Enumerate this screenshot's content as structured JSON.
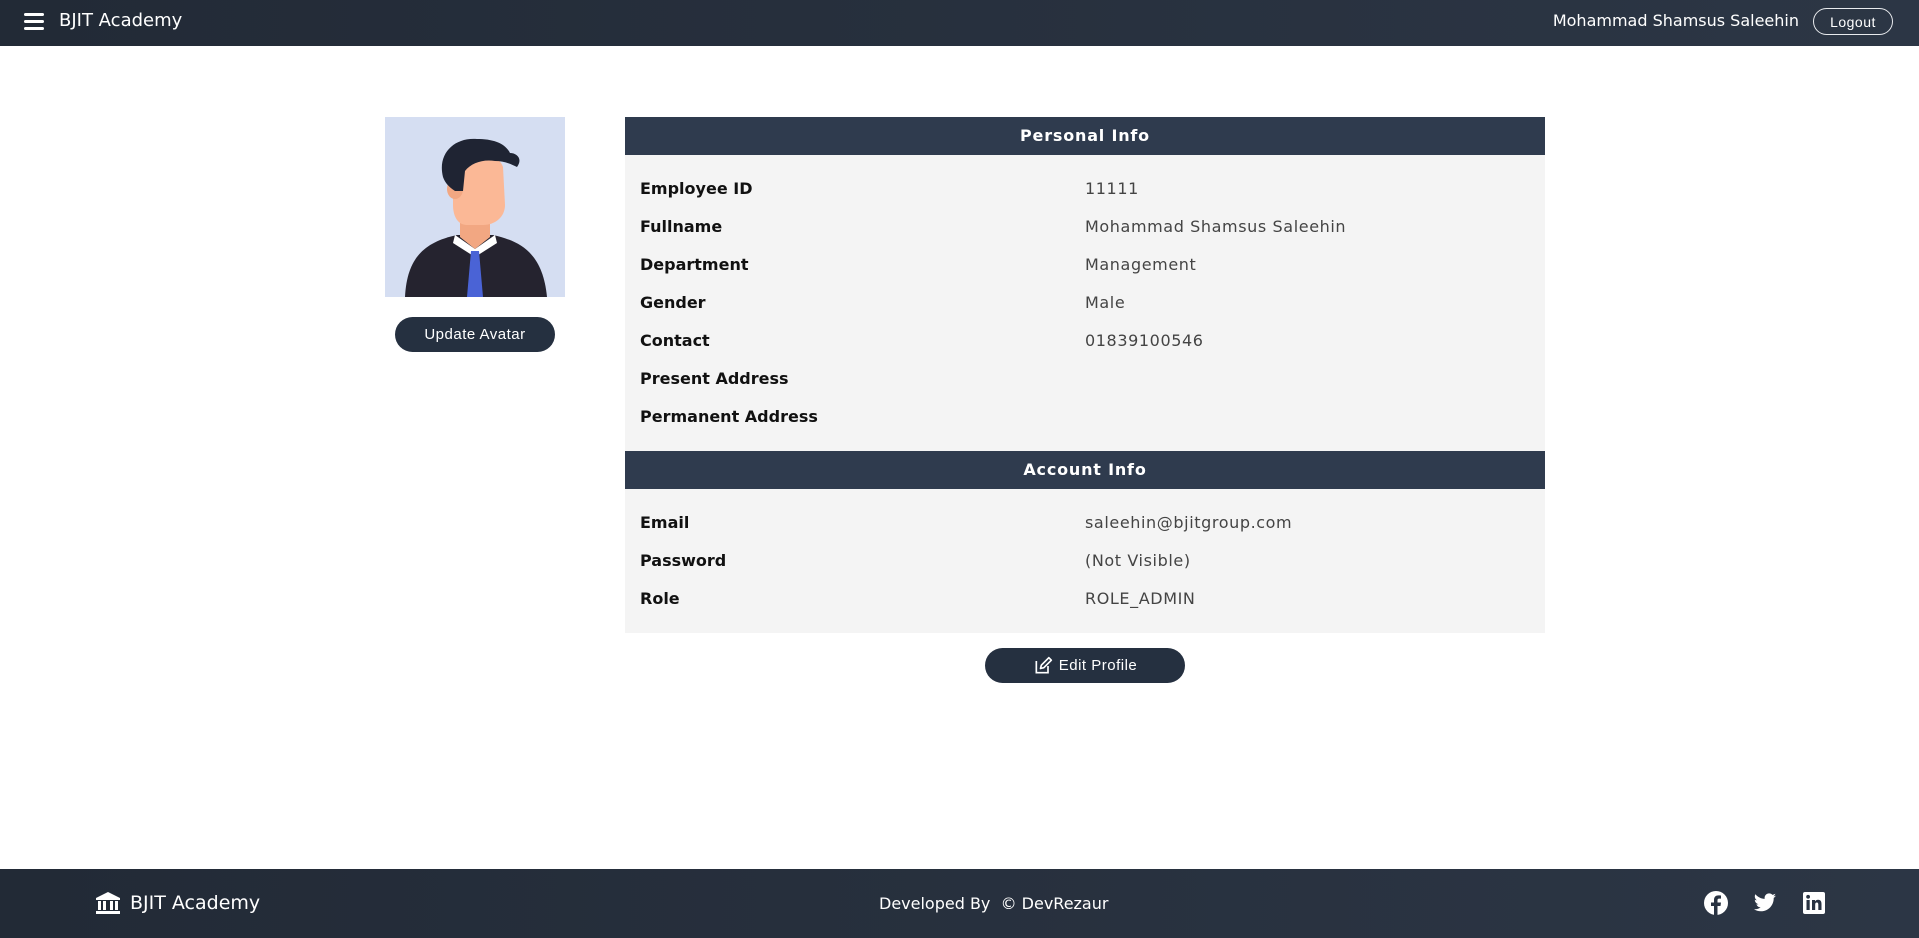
{
  "header": {
    "brand": "BJIT Academy",
    "user_name": "Mohammad Shamsus Saleehin",
    "logout_label": "Logout",
    "menu_icon": "hamburger-icon"
  },
  "avatar": {
    "update_label": "Update Avatar"
  },
  "personal_info": {
    "title": "Personal Info",
    "rows": [
      {
        "label": "Employee ID",
        "value": "11111"
      },
      {
        "label": "Fullname",
        "value": "Mohammad Shamsus Saleehin"
      },
      {
        "label": "Department",
        "value": "Management"
      },
      {
        "label": "Gender",
        "value": "Male"
      },
      {
        "label": "Contact",
        "value": "01839100546"
      },
      {
        "label": "Present Address",
        "value": ""
      },
      {
        "label": "Permanent Address",
        "value": ""
      }
    ]
  },
  "account_info": {
    "title": "Account Info",
    "rows": [
      {
        "label": "Email",
        "value": "saleehin@bjitgroup.com"
      },
      {
        "label": "Password",
        "value": "(Not Visible)"
      },
      {
        "label": "Role",
        "value": "ROLE_ADMIN"
      }
    ]
  },
  "actions": {
    "edit_label": "Edit Profile",
    "edit_icon": "edit-icon"
  },
  "footer": {
    "brand": "BJIT Academy",
    "brand_icon": "bank-icon",
    "credits": "Developed By  © DevRezaur",
    "social_icons": [
      "facebook-icon",
      "twitter-icon",
      "linkedin-icon"
    ]
  },
  "colors": {
    "header_bg": "#252d3a",
    "section_head": "#2f3b4e",
    "button_bg": "#253040",
    "panel_bg": "#f4f4f4",
    "avatar_bg": "#d5def2"
  }
}
